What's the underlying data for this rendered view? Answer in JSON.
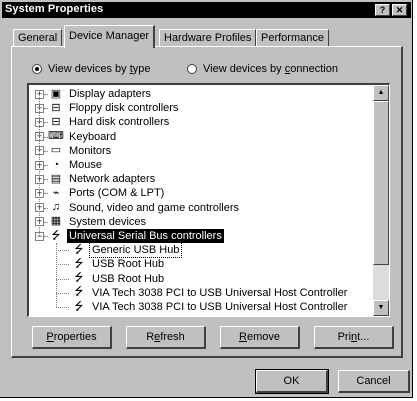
{
  "window": {
    "title": "System Properties",
    "help_label": "?",
    "close_label": "✕"
  },
  "tabs": [
    {
      "label": "General"
    },
    {
      "label": "Device Manager",
      "active": true
    },
    {
      "label": "Hardware Profiles"
    },
    {
      "label": "Performance"
    }
  ],
  "view": {
    "by_type": {
      "pre": "View devices by ",
      "key": "t",
      "post": "ype",
      "selected": true
    },
    "by_connection": {
      "pre": "View devices by ",
      "key": "c",
      "post": "onnection",
      "selected": false
    }
  },
  "devices": [
    {
      "label": "Display adapters",
      "icon": "display-adapter-icon",
      "glyph": "▣",
      "expander": "+"
    },
    {
      "label": "Floppy disk controllers",
      "icon": "floppy-controller-icon",
      "glyph": "⊟",
      "expander": "+"
    },
    {
      "label": "Hard disk controllers",
      "icon": "hard-disk-controller-icon",
      "glyph": "⊟",
      "expander": "+"
    },
    {
      "label": "Keyboard",
      "icon": "keyboard-icon",
      "glyph": "⌨",
      "expander": "+"
    },
    {
      "label": "Monitors",
      "icon": "monitor-icon",
      "glyph": "▭",
      "expander": "+"
    },
    {
      "label": "Mouse",
      "icon": "mouse-icon",
      "glyph": "◔",
      "expander": "+"
    },
    {
      "label": "Network adapters",
      "icon": "network-adapter-icon",
      "glyph": "▤",
      "expander": "+"
    },
    {
      "label": "Ports (COM & LPT)",
      "icon": "port-icon",
      "glyph": "⌁",
      "expander": "+"
    },
    {
      "label": "Sound, video and game controllers",
      "icon": "sound-controller-icon",
      "glyph": "♫",
      "expander": "+"
    },
    {
      "label": "System devices",
      "icon": "system-devices-icon",
      "glyph": "▦",
      "expander": "+"
    },
    {
      "label": "Universal Serial Bus controllers",
      "icon": "usb-icon",
      "glyph": "⭍",
      "expander": "−",
      "selected": true
    },
    {
      "label": "Generic USB Hub",
      "icon": "usb-icon",
      "glyph": "⭍",
      "child": true,
      "focused": true
    },
    {
      "label": "USB Root Hub",
      "icon": "usb-icon",
      "glyph": "⭍",
      "child": true
    },
    {
      "label": "USB Root Hub",
      "icon": "usb-icon",
      "glyph": "⭍",
      "child": true
    },
    {
      "label": "VIA Tech 3038 PCI to USB Universal Host Controller",
      "icon": "usb-icon",
      "glyph": "⭍",
      "child": true
    },
    {
      "label": "VIA Tech 3038 PCI to USB Universal Host Controller",
      "icon": "usb-icon",
      "glyph": "⭍",
      "child": true
    }
  ],
  "scrollbar": {
    "up": "▲",
    "down": "▼"
  },
  "actions": {
    "properties": {
      "pre": "",
      "key": "P",
      "post": "roperties"
    },
    "refresh": {
      "pre": "R",
      "key": "e",
      "post": "fresh"
    },
    "remove": {
      "pre": "",
      "key": "R",
      "post": "emove"
    },
    "print": {
      "pre": "Pri",
      "key": "n",
      "post": "t..."
    }
  },
  "footer": {
    "ok": "OK",
    "cancel": "Cancel"
  }
}
